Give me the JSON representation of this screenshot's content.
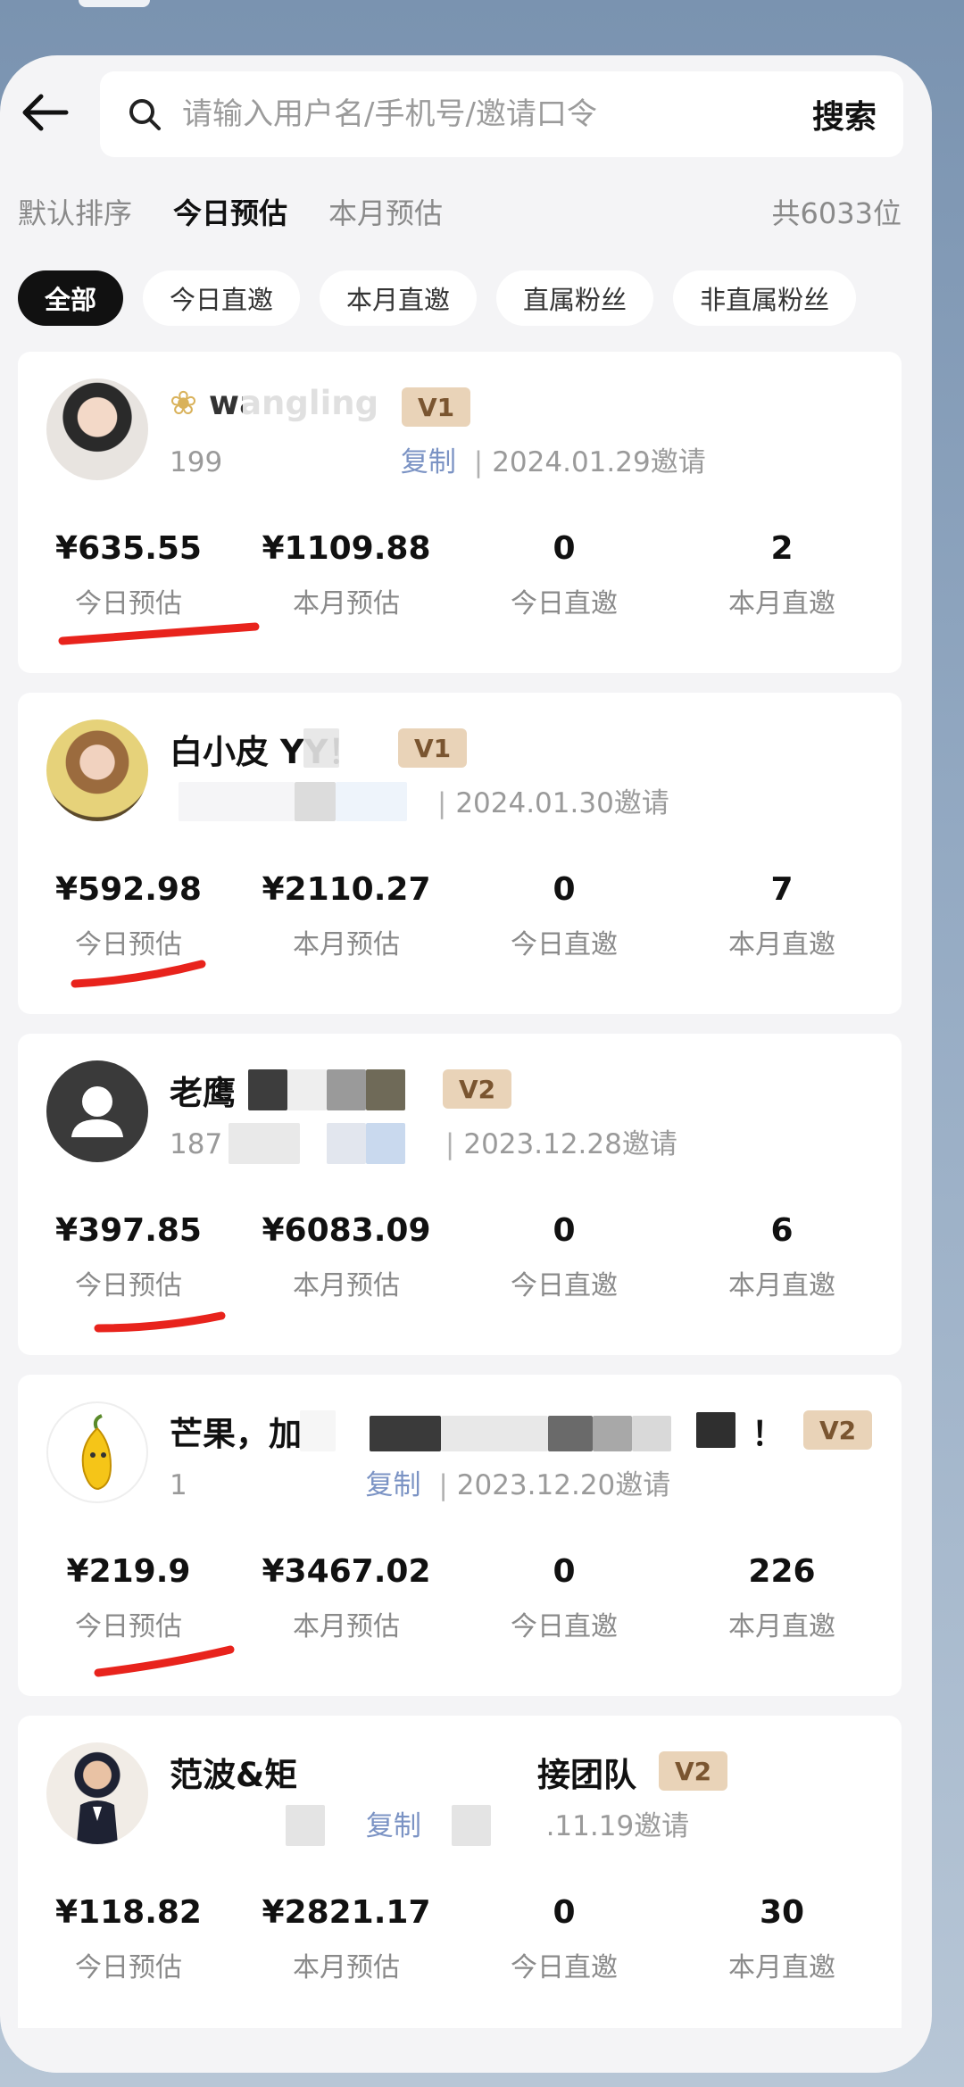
{
  "header": {
    "search_placeholder": "请输入用户名/手机号/邀请口令",
    "search_button": "搜索"
  },
  "sort": {
    "options": [
      "默认排序",
      "今日预估",
      "本月预估"
    ],
    "active_index": 1,
    "total_count": "共6033位"
  },
  "filters": {
    "chips": [
      "全部",
      "今日直邀",
      "本月直邀",
      "直属粉丝",
      "非直属粉丝"
    ],
    "active_index": 0
  },
  "labels": {
    "today_estimate": "今日预估",
    "month_estimate": "本月预估",
    "today_invites": "今日直邀",
    "month_invites": "本月直邀"
  },
  "members": [
    {
      "name": "wangling",
      "level": "V1",
      "phone": "199",
      "tag": "复制",
      "invite_date": "2024.01.29邀请",
      "today_estimate": "¥635.55",
      "month_estimate": "¥1109.88",
      "today_invites": "0",
      "month_invites": "2"
    },
    {
      "name": "白小皮 YY！",
      "level": "V1",
      "phone": "",
      "tag": "",
      "invite_date": "2024.01.30邀请",
      "today_estimate": "¥592.98",
      "month_estimate": "¥2110.27",
      "today_invites": "0",
      "month_invites": "7"
    },
    {
      "name": "老鹰",
      "level": "V2",
      "phone": "187",
      "tag": "",
      "invite_date": "2023.12.28邀请",
      "today_estimate": "¥397.85",
      "month_estimate": "¥6083.09",
      "today_invites": "0",
      "month_invites": "6"
    },
    {
      "name": "芒果，加",
      "name_tail": "！",
      "level": "V2",
      "phone": "1",
      "tag": "复制",
      "invite_date": "2023.12.20邀请",
      "today_estimate": "¥219.9",
      "month_estimate": "¥3467.02",
      "today_invites": "0",
      "month_invites": "226"
    },
    {
      "name": "范波&矩",
      "name_tail": "接团队",
      "level": "V2",
      "phone": "",
      "tag": "复制",
      "invite_date": ".11.19邀请",
      "today_estimate": "¥118.82",
      "month_estimate": "¥2821.17",
      "today_invites": "0",
      "month_invites": "30"
    }
  ],
  "colors": {
    "highlight_underline": "#e8231c",
    "badge_bg": "#e9d3b8",
    "badge_text": "#7a5530"
  },
  "icons": [
    "back-arrow-icon",
    "search-icon",
    "default-avatar-icon"
  ]
}
